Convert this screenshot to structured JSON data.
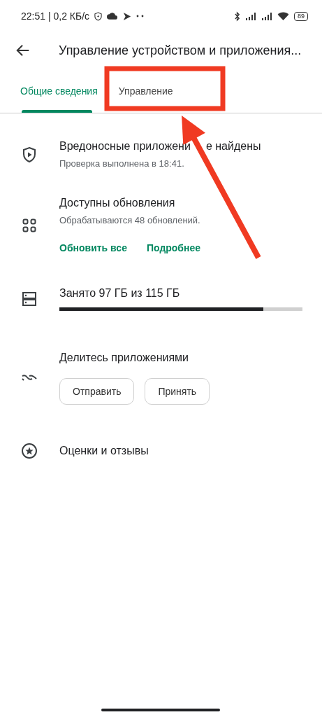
{
  "status_bar": {
    "time": "22:51 | 0,2 КБ/с",
    "battery": "89"
  },
  "app_bar": {
    "title": "Управление устройством и приложения..."
  },
  "tabs": [
    {
      "label": "Общие сведения",
      "selected": true
    },
    {
      "label": "Управление",
      "selected": false
    }
  ],
  "sections": [
    {
      "kind": "status",
      "title": "Вредоносные приложени",
      "title_after": "е найдены",
      "subtitle": "Проверка выполнена в 18:41."
    },
    {
      "kind": "updates",
      "title": "Доступны обновления",
      "subtitle": "Обрабатываются 48 обновлений.",
      "links": [
        "Обновить все",
        "Подробнее"
      ]
    },
    {
      "kind": "storage",
      "title": "Занято 97 ГБ из 115 ГБ",
      "level": 0.84
    },
    {
      "kind": "share",
      "title": "Делитесь приложениями",
      "buttons": [
        "Отправить",
        "Принять"
      ]
    },
    {
      "kind": "plain",
      "title": "Оценки и отзывы"
    }
  ]
}
